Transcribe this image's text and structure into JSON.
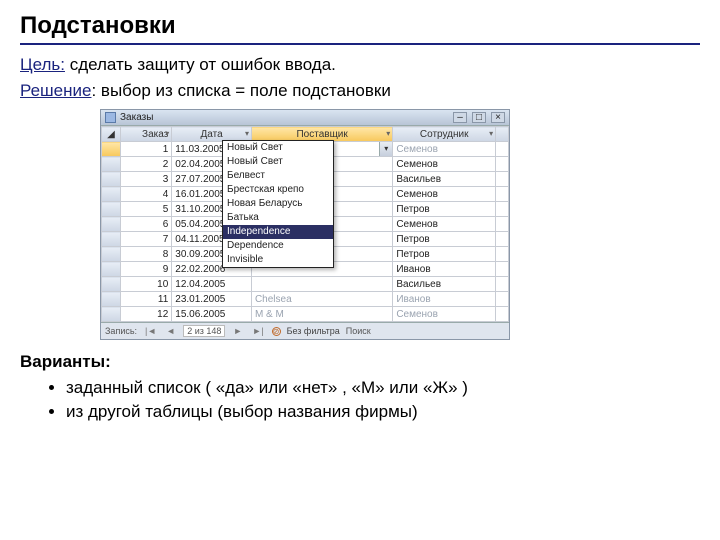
{
  "title": "Подстановки",
  "goal_label": "Цель:",
  "goal_text": " сделать защиту от ошибок ввода.",
  "solution_label": "Решение",
  "solution_text": ": выбор из списка = поле подстановки",
  "variants_label": "Варианты:",
  "variant1": "заданный список ( «да» или «нет» ,  «М» или «Ж» )",
  "variant2": "из другой таблицы (выбор названия фирмы)",
  "window": {
    "title": "Заказы",
    "columns": {
      "id": "Заказ",
      "date": "Дата",
      "supplier": "Поставщик",
      "employee": "Сотрудник"
    },
    "combo_value": "Новый Свет",
    "rows": [
      {
        "id": "1",
        "date": "11.03.2005",
        "supplier_combo": true,
        "employee": "Семенов"
      },
      {
        "id": "2",
        "date": "02.04.2005",
        "employee": "Семенов"
      },
      {
        "id": "3",
        "date": "27.07.2005",
        "employee": "Васильев"
      },
      {
        "id": "4",
        "date": "16.01.2005",
        "employee": "Семенов"
      },
      {
        "id": "5",
        "date": "31.10.2005",
        "employee": "Петров"
      },
      {
        "id": "6",
        "date": "05.04.2005",
        "employee": "Семенов"
      },
      {
        "id": "7",
        "date": "04.11.2005",
        "employee": "Петров"
      },
      {
        "id": "8",
        "date": "30.09.2005",
        "employee": "Петров"
      },
      {
        "id": "9",
        "date": "22.02.2006",
        "employee": "Иванов"
      },
      {
        "id": "10",
        "date": "12.04.2005",
        "employee": "Васильев"
      },
      {
        "id": "11",
        "date": "23.01.2005",
        "supplier": "Chelsea",
        "employee": "Иванов"
      },
      {
        "id": "12",
        "date": "15.06.2005",
        "supplier": "M & M",
        "employee": "Семенов"
      }
    ],
    "dropdown": [
      "Новый Свет",
      "Новый Свет",
      "Белвест",
      "Брестская крепо",
      "Новая Беларусь",
      "Батька",
      "Independence",
      "Dependence",
      "Invisible"
    ],
    "dropdown_selected_index": 6,
    "status": {
      "label": "Запись:",
      "first": "|◄",
      "prev": "◄",
      "value": "2 из 148",
      "next": "►",
      "last": "►|",
      "nofilter": "Без фильтра",
      "search": "Поиск"
    }
  }
}
